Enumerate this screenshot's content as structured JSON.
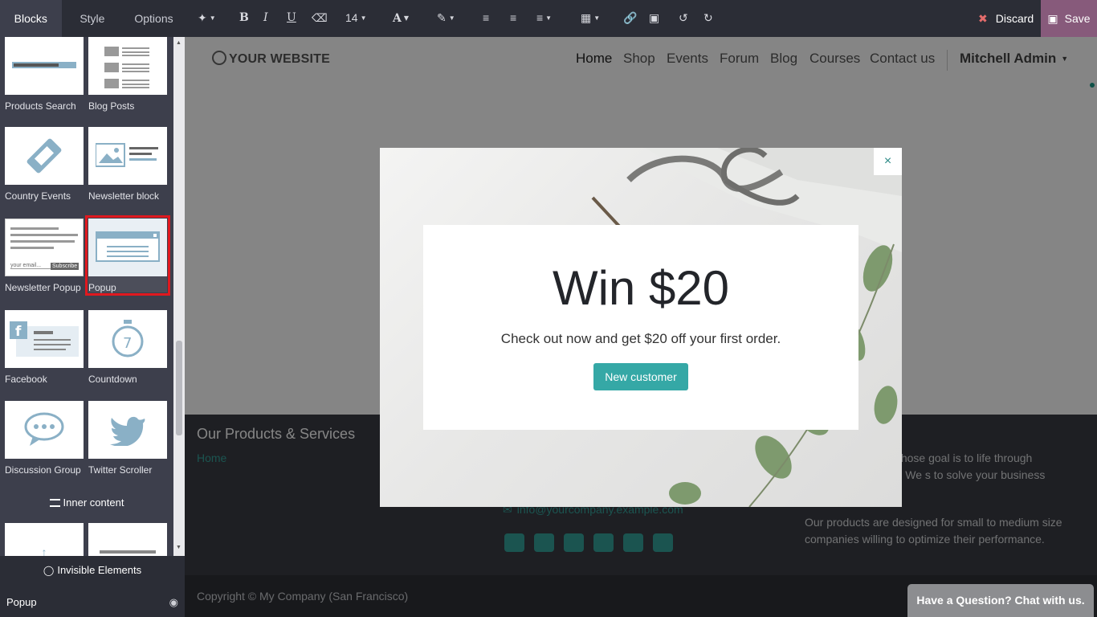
{
  "sidebar": {
    "tabs": [
      "Blocks",
      "Style",
      "Options"
    ],
    "snippets": [
      {
        "label": "Products Search"
      },
      {
        "label": "Blog Posts"
      },
      {
        "label": "Country Events"
      },
      {
        "label": "Newsletter block"
      },
      {
        "label": "Newsletter Popup",
        "thumb_input": "your email...",
        "thumb_button": "Subscribe"
      },
      {
        "label": "Popup"
      },
      {
        "label": "Facebook"
      },
      {
        "label": "Countdown"
      },
      {
        "label": "Discussion Group"
      },
      {
        "label": "Twitter Scroller"
      }
    ],
    "section_inner": "Inner content",
    "invisible_elements_title": "Invisible Elements",
    "invisible_item": "Popup"
  },
  "toolbar": {
    "font_size": "14",
    "discard_label": "Discard",
    "save_label": "Save",
    "accent_color": "#875a7b"
  },
  "site": {
    "logo": "YOUR WEBSITE",
    "nav": [
      "Home",
      "Shop",
      "Events",
      "Forum",
      "Blog",
      "Courses",
      "Contact us"
    ],
    "user": "Mitchell Admin",
    "footer": {
      "heading": "Our Products & Services",
      "home_link": "Home",
      "email": "info@yourcompany.example.com",
      "about1": "assionate people whose goal is to life through disruptive products. We s to solve your business problems.",
      "about2": "Our products are designed for small to medium size companies willing to optimize their performance."
    },
    "copyright": "Copyright © My Company (San Francisco)",
    "chat": "Have a Question? Chat with us."
  },
  "modal": {
    "title": "Win $20",
    "text": "Check out now and get $20 off your first order.",
    "button": "New customer",
    "close": "×",
    "button_color": "#35a8a6"
  }
}
